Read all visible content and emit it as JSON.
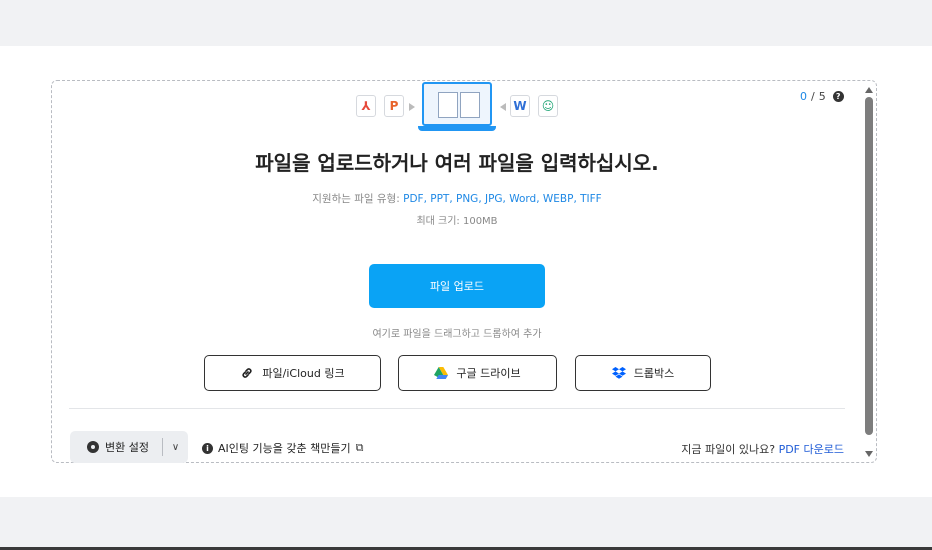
{
  "counter": {
    "current": "0",
    "separator": "/",
    "max": "5",
    "help": "?"
  },
  "formats": {
    "pdf": "⅄",
    "ppt": "P",
    "word": "W",
    "image": "☺"
  },
  "headline": "파일을 업로드하거나 여러 파일을 입력하십시오.",
  "supported": {
    "label": "지원하는 파일 유형: ",
    "types": "PDF, PPT, PNG, JPG, Word, WEBP, TIFF"
  },
  "max_size": "최대 크기: 100MB",
  "upload_button": "파일 업로드",
  "drag_hint": "여기로 파일을 드래그하고 드롭하여 추가",
  "sources": {
    "link": "파일/iCloud 링크",
    "gdrive": "구글 드라이브",
    "dropbox": "드롭박스"
  },
  "settings": {
    "label": "변환 설정",
    "chevron": "∨"
  },
  "ai_book": {
    "info": "i",
    "label": "AI인팅 기능을 갖춘 책만들기",
    "ext": "⧉"
  },
  "download_hint": {
    "text": "지금 파일이 있나요? ",
    "link": "PDF 다운로드"
  },
  "colors": {
    "accent": "#0aa3f5",
    "link": "#1e5bd6",
    "counter": "#1e88e5"
  }
}
